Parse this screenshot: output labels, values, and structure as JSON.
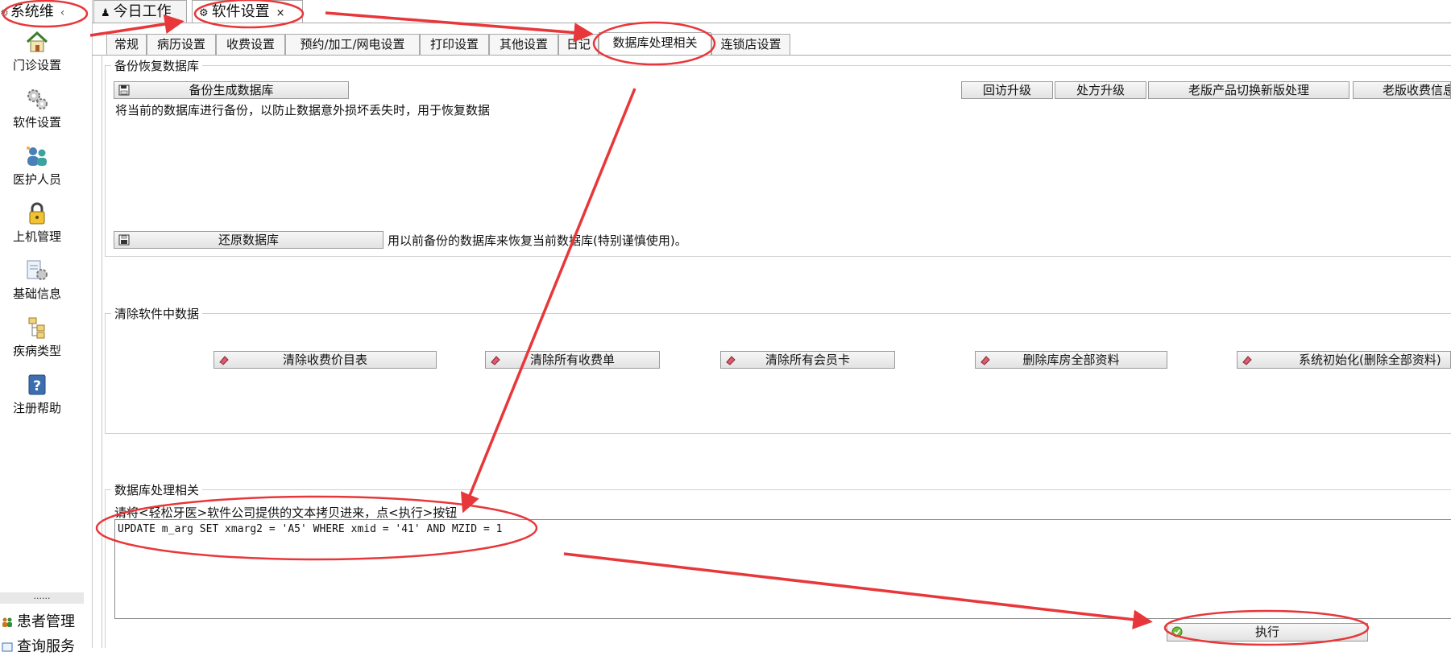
{
  "sidebar": {
    "title": "系统维",
    "chevron": "‹",
    "items": [
      {
        "label": "门诊设置",
        "icon": "house-icon"
      },
      {
        "label": "软件设置",
        "icon": "gears-icon"
      },
      {
        "label": "医护人员",
        "icon": "people-icon"
      },
      {
        "label": "上机管理",
        "icon": "lock-icon"
      },
      {
        "label": "基础信息",
        "icon": "info-gear-icon"
      },
      {
        "label": "疾病类型",
        "icon": "tree-icon"
      },
      {
        "label": "注册帮助",
        "icon": "help-icon"
      }
    ],
    "dots": "......",
    "bottom_items": [
      {
        "label": "患者管理",
        "icon": "patients-icon"
      },
      {
        "label": "查询服务",
        "icon": "query-icon"
      }
    ]
  },
  "doc_tabs": [
    {
      "label": "今日工作",
      "icon": "person-icon"
    },
    {
      "label": "软件设置",
      "icon": "gear-icon",
      "close": "×"
    }
  ],
  "settings_tabs": [
    "常规",
    "病历设置",
    "收费设置",
    "预约/加工/网电设置",
    "打印设置",
    "其他设置",
    "日记",
    "数据库处理相关",
    "连锁店设置"
  ],
  "backup": {
    "title": "备份恢复数据库",
    "backup_button": "备份生成数据库",
    "backup_desc": "将当前的数据库进行备份，以防止数据意外损坏丢失时，用于恢复数据",
    "restore_button": "还原数据库",
    "restore_desc": "用以前备份的数据库来恢复当前数据库(特别谨慎使用)。",
    "upgrade_buttons": [
      "回访升级",
      "处方升级",
      "老版产品切换新版处理",
      "老版收费信息"
    ]
  },
  "clear": {
    "title": "清除软件中数据",
    "buttons": [
      "清除收费价目表",
      "清除所有收费单",
      "清除所有会员卡",
      "删除库房全部资料",
      "系统初始化(删除全部资料)"
    ]
  },
  "db": {
    "title": "数据库处理相关",
    "instruction": "请将<轻松牙医>软件公司提供的文本拷贝进来，点<执行>按钮",
    "sql": "UPDATE m_arg SET xmarg2 = 'A5' WHERE xmid = '41' AND MZID = 1",
    "execute_button": "执行"
  },
  "colors": {
    "annotation": "#e8373a",
    "border": "#a9a9a9"
  }
}
